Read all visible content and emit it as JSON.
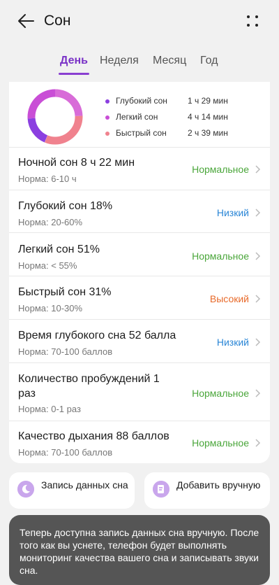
{
  "header": {
    "title": "Сон"
  },
  "tabs": [
    {
      "label": "День"
    },
    {
      "label": "Неделя"
    },
    {
      "label": "Месяц"
    },
    {
      "label": "Год"
    }
  ],
  "summary": {
    "legend": [
      {
        "label": "Глубокий сон",
        "value": "1 ч 29 мин",
        "color": "#8b3fe0"
      },
      {
        "label": "Легкий сон",
        "value": "4 ч 14 мин",
        "color": "#c94ed6"
      },
      {
        "label": "Быстрый сон",
        "value": "2 ч 39 мин",
        "color": "#f0828e"
      }
    ]
  },
  "metrics": [
    {
      "title": "Ночной сон  8 ч 22 мин",
      "norm": "Норма: 6-10 ч",
      "status": "Нормальное",
      "status_color": "#4aa63a"
    },
    {
      "title": "Глубокий сон  18%",
      "norm": "Норма: 20-60%",
      "status": "Низкий",
      "status_color": "#2a86d6"
    },
    {
      "title": "Легкий сон  51%",
      "norm": "Норма: < 55%",
      "status": "Нормальное",
      "status_color": "#4aa63a"
    },
    {
      "title": "Быстрый сон  31%",
      "norm": "Норма: 10-30%",
      "status": "Высокий",
      "status_color": "#e86a2a"
    },
    {
      "title": "Время глубокого сна  52 балла",
      "norm": "Норма: 70-100 баллов",
      "status": "Низкий",
      "status_color": "#2a86d6"
    },
    {
      "title": "Количество пробуждений  1 раз",
      "norm": "Норма: 0-1 раз",
      "status": "Нормальное",
      "status_color": "#4aa63a"
    },
    {
      "title": "Качество дыхания  88 баллов",
      "norm": "Норма: 70-100 баллов",
      "status": "Нормальное",
      "status_color": "#4aa63a"
    }
  ],
  "actions": {
    "record_label": "Запись данных сна",
    "add_label": "Добавить вручную"
  },
  "toast": {
    "text": "Теперь доступна запись данных сна вручную. После того как вы уснете, телефон будет выполнять мониторинг качества вашего сна и записывать звуки сна."
  }
}
